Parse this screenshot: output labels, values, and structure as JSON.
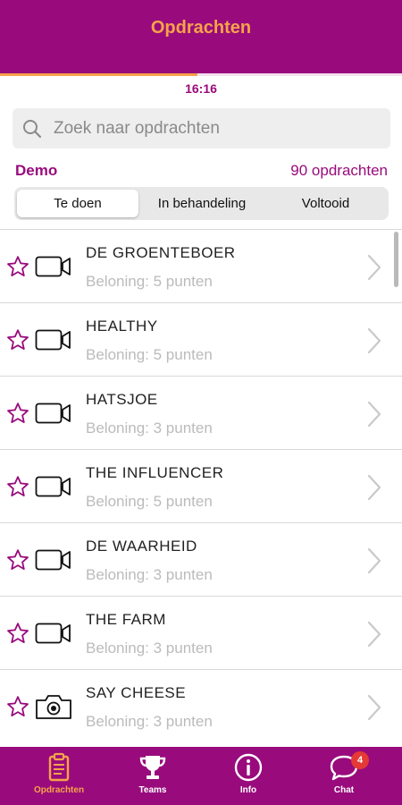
{
  "header": {
    "title": "Opdrachten",
    "timer": "16:16",
    "progress_fraction": 0.49
  },
  "search": {
    "placeholder": "Zoek naar opdrachten",
    "value": ""
  },
  "meta": {
    "group": "Demo",
    "count_label": "90 opdrachten"
  },
  "tabs": [
    {
      "label": "Te doen",
      "active": true
    },
    {
      "label": "In behandeling",
      "active": false
    },
    {
      "label": "Voltooid",
      "active": false
    }
  ],
  "assignments": [
    {
      "title": "DE GROENTEBOER",
      "reward": "Beloning: 5 punten",
      "media_icon": "video-icon"
    },
    {
      "title": "HEALTHY",
      "reward": "Beloning: 5 punten",
      "media_icon": "video-icon"
    },
    {
      "title": "HATSJOE",
      "reward": "Beloning: 3 punten",
      "media_icon": "video-icon"
    },
    {
      "title": "THE INFLUENCER",
      "reward": "Beloning: 5 punten",
      "media_icon": "video-icon"
    },
    {
      "title": "DE WAARHEID",
      "reward": "Beloning: 3 punten",
      "media_icon": "video-icon"
    },
    {
      "title": "THE FARM",
      "reward": "Beloning: 3 punten",
      "media_icon": "video-icon"
    },
    {
      "title": "SAY CHEESE",
      "reward": "Beloning: 3 punten",
      "media_icon": "camera-icon"
    }
  ],
  "bottom_nav": [
    {
      "label": "Opdrachten",
      "icon": "clipboard-icon",
      "active": true
    },
    {
      "label": "Teams",
      "icon": "trophy-icon",
      "active": false
    },
    {
      "label": "Info",
      "icon": "info-icon",
      "active": false
    },
    {
      "label": "Chat",
      "icon": "chat-icon",
      "active": false,
      "badge": "4"
    }
  ],
  "colors": {
    "brand": "#990b7c",
    "accent": "#f5a34a",
    "badge": "#e53935"
  }
}
